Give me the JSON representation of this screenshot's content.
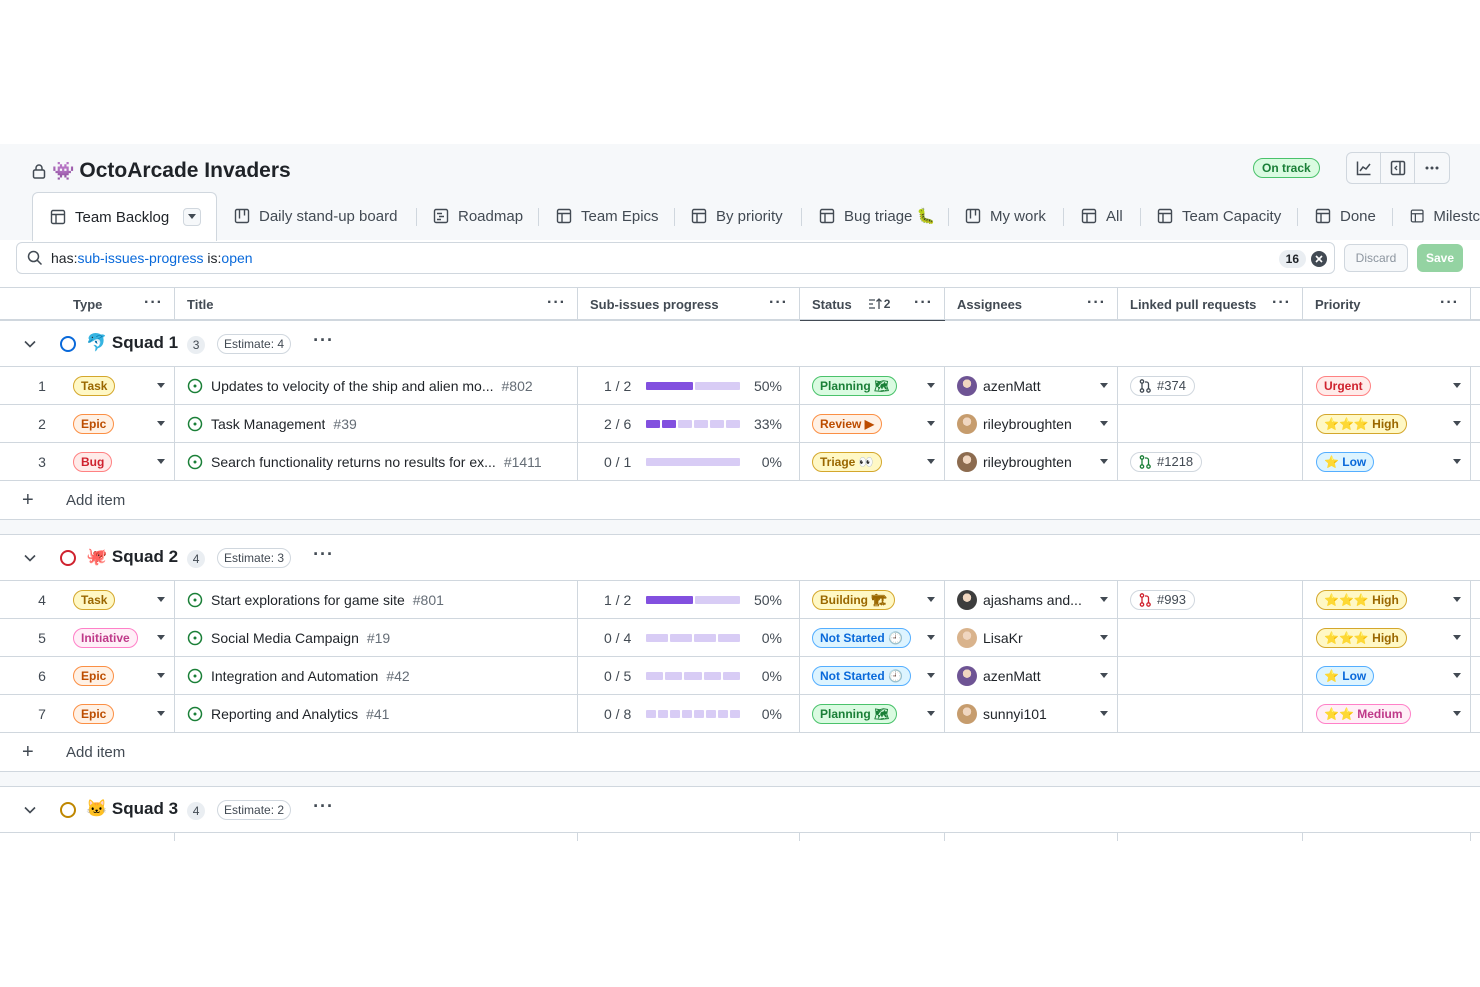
{
  "project": {
    "title": "OctoArcade Invaders",
    "emoji": "👾",
    "status": "On track"
  },
  "tabs": [
    {
      "label": "Team Backlog",
      "x": 0
    },
    {
      "label": "Daily stand-up board"
    },
    {
      "label": "Roadmap"
    },
    {
      "label": "Team Epics"
    },
    {
      "label": "By priority"
    },
    {
      "label": "Bug triage 🐛"
    },
    {
      "label": "My work"
    },
    {
      "label": "All"
    },
    {
      "label": "Team Capacity"
    },
    {
      "label": "Done"
    },
    {
      "label": "Milestc"
    }
  ],
  "filter": {
    "key1": "has:",
    "val1": "sub-issues-progress",
    "key2": " is:",
    "val2": "open",
    "count": "16",
    "discard": "Discard",
    "save": "Save"
  },
  "columns": {
    "type": "Type",
    "title": "Title",
    "progress": "Sub-issues progress",
    "status": "Status",
    "status_sort": "2",
    "assignees": "Assignees",
    "linked": "Linked pull requests",
    "priority": "Priority"
  },
  "groups": [
    {
      "name": "Squad 1",
      "emoji": "🐬",
      "count": "3",
      "estimate": "Estimate: 4",
      "color": "#0969da",
      "rows": [
        {
          "num": "1",
          "type": "Task",
          "title": "Updates to velocity of the ship and alien mo...",
          "issue": "#802",
          "frac": "1 / 2",
          "done": 1,
          "total": 2,
          "pct": "50%",
          "status": "Planning 🗺",
          "assignee": "azenMatt",
          "pr": "#374",
          "priority": "Urgent"
        },
        {
          "num": "2",
          "type": "Epic",
          "title": "Task Management",
          "issue": "#39",
          "frac": "2 / 6",
          "done": 2,
          "total": 6,
          "pct": "33%",
          "status": "Review ▶",
          "assignee": "rileybroughten",
          "pr": "",
          "priority": "⭐⭐⭐ High"
        },
        {
          "num": "3",
          "type": "Bug",
          "title": "Search functionality returns no results for ex...",
          "issue": "#1411",
          "frac": "0 / 1",
          "done": 0,
          "total": 1,
          "pct": "0%",
          "status": "Triage 👀",
          "assignee": "rileybroughten",
          "pr": "#1218",
          "priority": "⭐ Low"
        }
      ],
      "add_label": "Add item"
    },
    {
      "name": "Squad 2",
      "emoji": "🐙",
      "count": "4",
      "estimate": "Estimate: 3",
      "color": "#cf222e",
      "rows": [
        {
          "num": "4",
          "type": "Task",
          "title": "Start explorations for game site",
          "issue": "#801",
          "frac": "1 / 2",
          "done": 1,
          "total": 2,
          "pct": "50%",
          "status": "Building 🏗",
          "assignee": "ajashams and...",
          "pr": "#993",
          "priority": "⭐⭐⭐ High"
        },
        {
          "num": "5",
          "type": "Initiative",
          "title": "Social Media Campaign",
          "issue": "#19",
          "frac": "0 / 4",
          "done": 0,
          "total": 4,
          "pct": "0%",
          "status": "Not Started 🕘",
          "assignee": "LisaKr",
          "pr": "",
          "priority": "⭐⭐⭐ High"
        },
        {
          "num": "6",
          "type": "Epic",
          "title": "Integration and Automation",
          "issue": "#42",
          "frac": "0 / 5",
          "done": 0,
          "total": 5,
          "pct": "0%",
          "status": "Not Started 🕘",
          "assignee": "azenMatt",
          "pr": "",
          "priority": "⭐ Low"
        },
        {
          "num": "7",
          "type": "Epic",
          "title": "Reporting and Analytics",
          "issue": "#41",
          "frac": "0 / 8",
          "done": 0,
          "total": 8,
          "pct": "0%",
          "status": "Planning 🗺",
          "assignee": "sunnyi101",
          "pr": "",
          "priority": "⭐⭐ Medium"
        }
      ],
      "add_label": "Add item"
    },
    {
      "name": "Squad 3",
      "emoji": "🐱",
      "count": "4",
      "estimate": "Estimate: 2",
      "color": "#bf8700",
      "rows": [],
      "add_label": ""
    }
  ],
  "colors": {
    "task": "#9a6700",
    "epic": "#bc4c00",
    "bug": "#cf222e",
    "initiative": "#bf3989",
    "planning": "#1a7f37",
    "review": "#bc4c00",
    "triage": "#9a6700",
    "building": "#9a6700",
    "not_started": "#0969da",
    "urgent": "#cf222e",
    "high": "#9a6700",
    "low": "#0969da",
    "medium": "#bf3989"
  },
  "icons": {
    "lock": "lock-icon",
    "graph": "graph-icon",
    "panel": "sidebar-panel-icon",
    "more": "kebab-icon",
    "table": "table-icon",
    "board": "board-icon",
    "roadmap": "roadmap-icon",
    "search": "search-icon",
    "clear": "x-circle-icon",
    "issue": "issue-open-icon",
    "pr": "pull-request-icon",
    "chevron": "chevron-down-icon"
  }
}
